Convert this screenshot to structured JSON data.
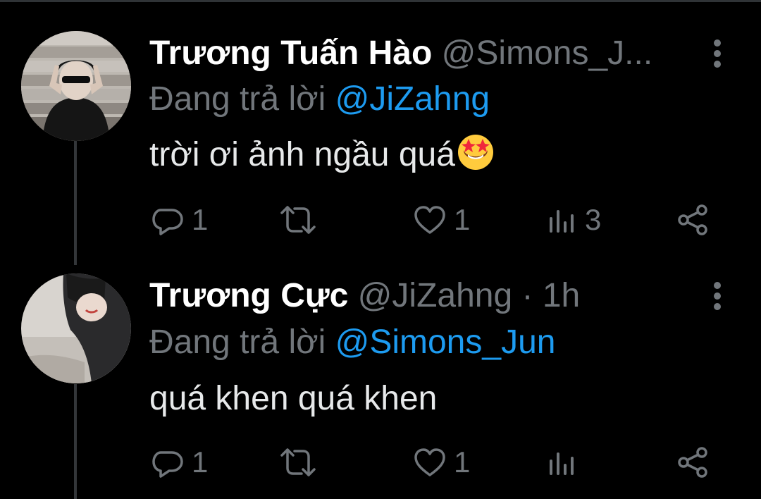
{
  "colors": {
    "background": "#000000",
    "name": "#ffffff",
    "secondary": "#71767b",
    "mention": "#1d9bf0",
    "text": "#e7e9ea"
  },
  "tweets": [
    {
      "display_name": "Trương Tuấn Hào",
      "handle_meta": "@Simons_J...",
      "reply_prefix": "Đang trả lời",
      "reply_to": "@JiZahng",
      "text": "trời ơi ảnh ngầu quá",
      "emoji": "star-struck-emoji",
      "replies": "1",
      "retweets": "",
      "likes": "1",
      "views": "3"
    },
    {
      "display_name": "Trương Cực",
      "handle_meta": "@JiZahng · 1h",
      "reply_prefix": "Đang trả lời",
      "reply_to": "@Simons_Jun",
      "text": "quá khen quá khen",
      "replies": "1",
      "retweets": "",
      "likes": "1",
      "views": ""
    }
  ],
  "icons": {
    "reply": "reply-icon",
    "retweet": "retweet-icon",
    "like": "heart-icon",
    "views": "views-icon",
    "share": "share-icon",
    "more": "more-vertical-icon"
  }
}
